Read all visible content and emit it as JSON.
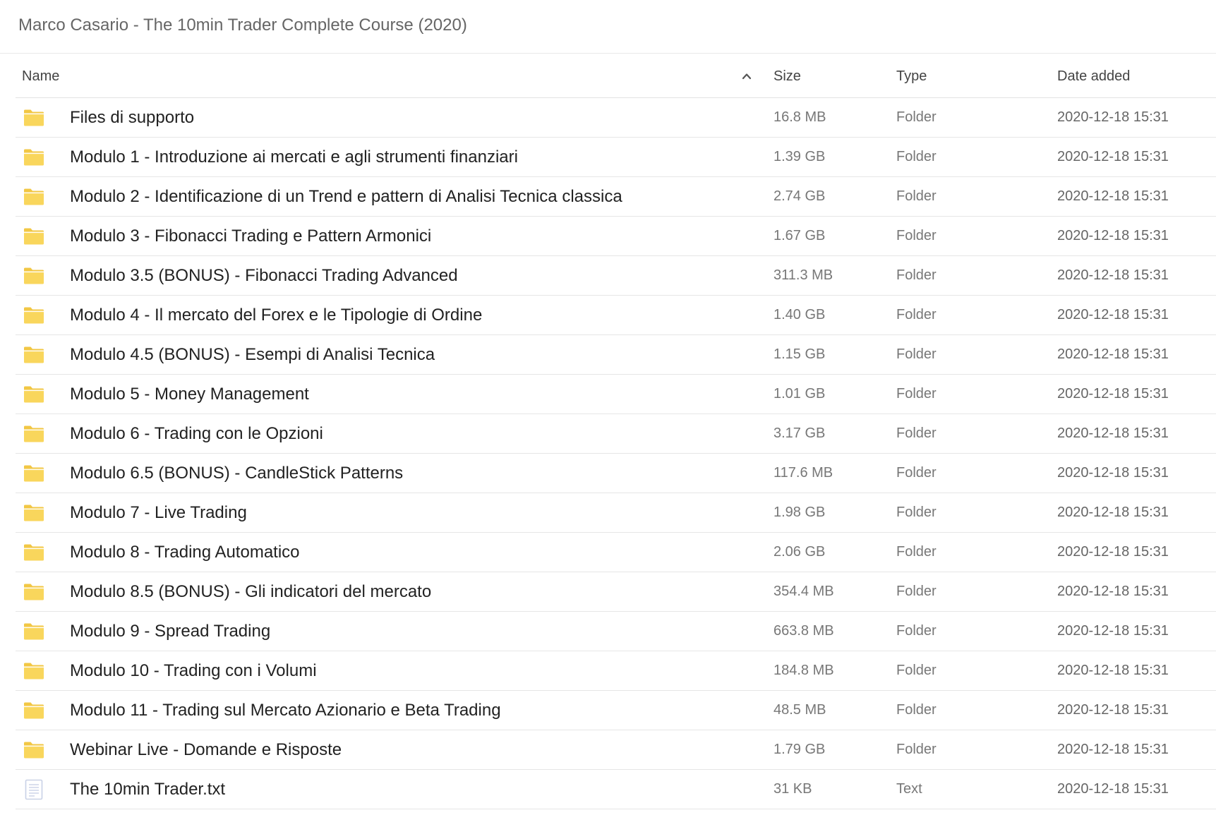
{
  "breadcrumb": "Marco Casario - The 10min Trader Complete Course (2020)",
  "columns": {
    "name": "Name",
    "size": "Size",
    "type": "Type",
    "date": "Date added"
  },
  "sort": {
    "column": "name",
    "direction": "ascending",
    "icon": "chevron-up-icon"
  },
  "colors": {
    "folder": "#f9d65c",
    "folder_tab": "#f2c744",
    "text_file": "#c9d1e6"
  },
  "rows": [
    {
      "name": "Files di supporto",
      "size": "16.8 MB",
      "type": "Folder",
      "date": "2020-12-18 15:31",
      "icon": "folder-icon"
    },
    {
      "name": "Modulo 1 - Introduzione ai mercati e agli strumenti finanziari",
      "size": "1.39 GB",
      "type": "Folder",
      "date": "2020-12-18 15:31",
      "icon": "folder-icon"
    },
    {
      "name": "Modulo 2 - Identificazione di un Trend e pattern di Analisi Tecnica classica",
      "size": "2.74 GB",
      "type": "Folder",
      "date": "2020-12-18 15:31",
      "icon": "folder-icon"
    },
    {
      "name": "Modulo 3 - Fibonacci Trading e Pattern Armonici",
      "size": "1.67 GB",
      "type": "Folder",
      "date": "2020-12-18 15:31",
      "icon": "folder-icon"
    },
    {
      "name": "Modulo 3.5 (BONUS) - Fibonacci Trading Advanced",
      "size": "311.3 MB",
      "type": "Folder",
      "date": "2020-12-18 15:31",
      "icon": "folder-icon"
    },
    {
      "name": "Modulo 4 - Il mercato del Forex e le Tipologie di Ordine",
      "size": "1.40 GB",
      "type": "Folder",
      "date": "2020-12-18 15:31",
      "icon": "folder-icon"
    },
    {
      "name": "Modulo 4.5 (BONUS) - Esempi di Analisi Tecnica",
      "size": "1.15 GB",
      "type": "Folder",
      "date": "2020-12-18 15:31",
      "icon": "folder-icon"
    },
    {
      "name": "Modulo 5 - Money Management",
      "size": "1.01 GB",
      "type": "Folder",
      "date": "2020-12-18 15:31",
      "icon": "folder-icon"
    },
    {
      "name": "Modulo 6 - Trading con le Opzioni",
      "size": "3.17 GB",
      "type": "Folder",
      "date": "2020-12-18 15:31",
      "icon": "folder-icon"
    },
    {
      "name": "Modulo 6.5 (BONUS) - CandleStick Patterns",
      "size": "117.6 MB",
      "type": "Folder",
      "date": "2020-12-18 15:31",
      "icon": "folder-icon"
    },
    {
      "name": "Modulo 7 - Live Trading",
      "size": "1.98 GB",
      "type": "Folder",
      "date": "2020-12-18 15:31",
      "icon": "folder-icon"
    },
    {
      "name": "Modulo 8 - Trading Automatico",
      "size": "2.06 GB",
      "type": "Folder",
      "date": "2020-12-18 15:31",
      "icon": "folder-icon"
    },
    {
      "name": "Modulo 8.5 (BONUS) - Gli indicatori del mercato",
      "size": "354.4 MB",
      "type": "Folder",
      "date": "2020-12-18 15:31",
      "icon": "folder-icon"
    },
    {
      "name": "Modulo 9 - Spread Trading",
      "size": "663.8 MB",
      "type": "Folder",
      "date": "2020-12-18 15:31",
      "icon": "folder-icon"
    },
    {
      "name": "Modulo 10 - Trading con i Volumi",
      "size": "184.8 MB",
      "type": "Folder",
      "date": "2020-12-18 15:31",
      "icon": "folder-icon"
    },
    {
      "name": "Modulo 11 - Trading sul Mercato Azionario e Beta Trading",
      "size": "48.5 MB",
      "type": "Folder",
      "date": "2020-12-18 15:31",
      "icon": "folder-icon"
    },
    {
      "name": "Webinar Live - Domande e Risposte",
      "size": "1.79 GB",
      "type": "Folder",
      "date": "2020-12-18 15:31",
      "icon": "folder-icon"
    },
    {
      "name": "The 10min Trader.txt",
      "size": "31 KB",
      "type": "Text",
      "date": "2020-12-18 15:31",
      "icon": "text-file-icon"
    }
  ]
}
